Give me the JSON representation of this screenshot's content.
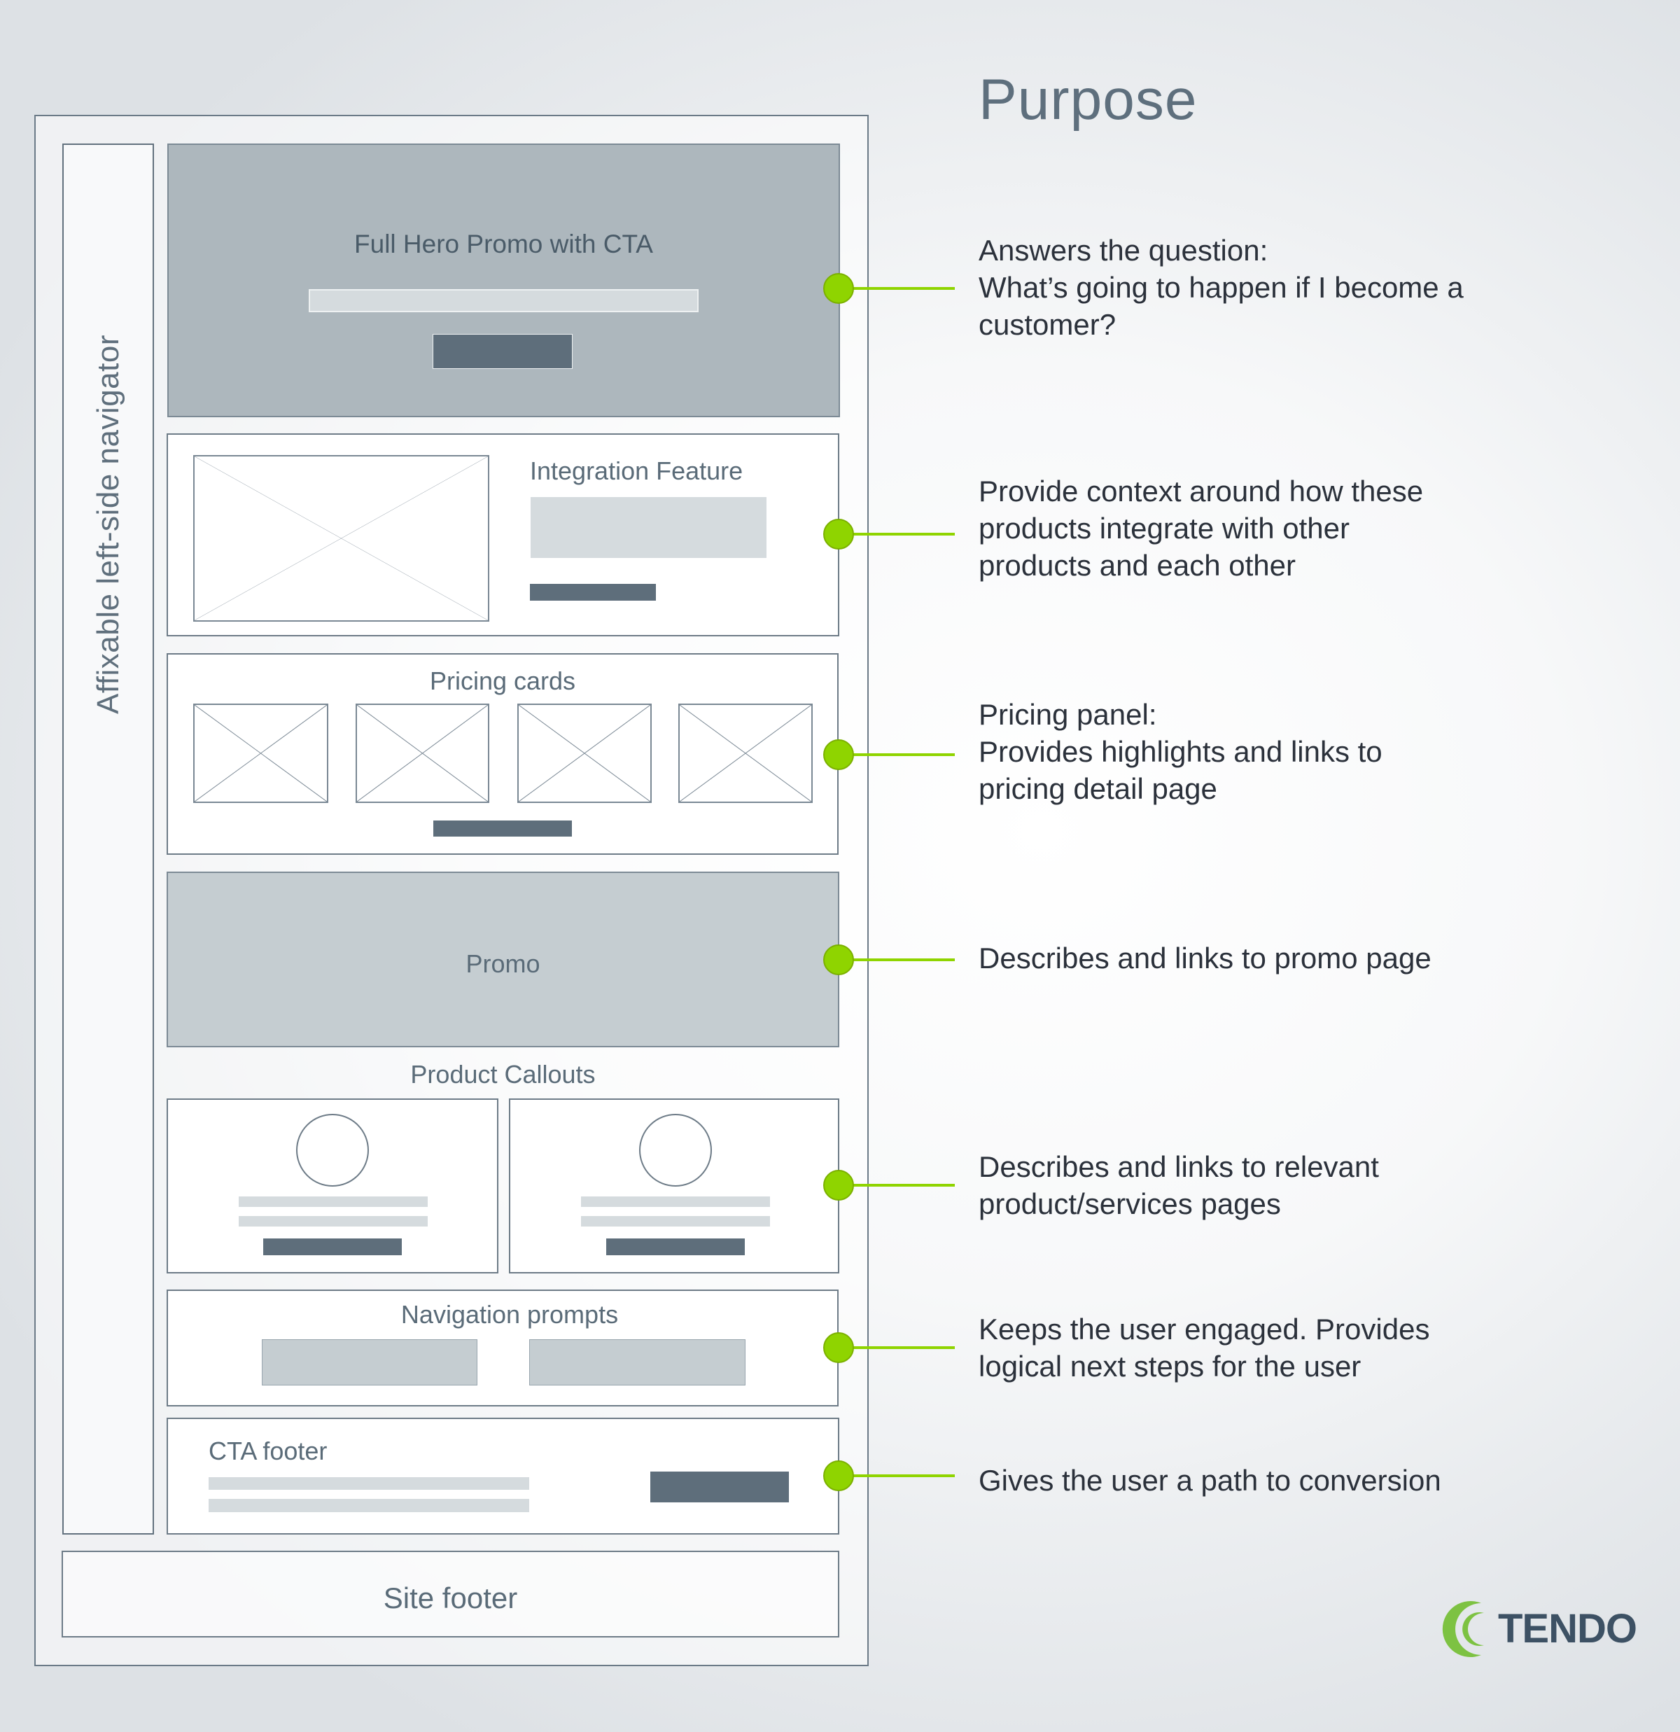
{
  "purpose_title": "Purpose",
  "wireframe": {
    "nav_label": "Affixable left-side navigator",
    "hero": {
      "title": "Full Hero Promo with CTA"
    },
    "integration": {
      "title": "Integration Feature"
    },
    "pricing": {
      "title": "Pricing cards",
      "card_count": 4
    },
    "promo": {
      "title": "Promo"
    },
    "product_callouts": {
      "title": "Product Callouts",
      "card_count": 2
    },
    "navigation_prompts": {
      "title": "Navigation prompts"
    },
    "cta_footer": {
      "title": "CTA footer"
    },
    "site_footer": {
      "title": "Site footer"
    }
  },
  "annotations": [
    {
      "section": "hero",
      "lines": [
        "Answers the question:",
        "What’s going to happen if I become a",
        "customer?"
      ]
    },
    {
      "section": "integration",
      "lines": [
        "Provide context around how these",
        "products integrate with other",
        "products and each other"
      ]
    },
    {
      "section": "pricing",
      "lines": [
        "Pricing panel:",
        "Provides highlights and links to",
        "pricing detail page"
      ]
    },
    {
      "section": "promo",
      "lines": [
        "Describes and links to promo page"
      ]
    },
    {
      "section": "product_callouts",
      "lines": [
        "Describes and links to relevant",
        "product/services pages"
      ]
    },
    {
      "section": "navigation_prompts",
      "lines": [
        "Keeps the user engaged. Provides",
        "logical next steps for the user"
      ]
    },
    {
      "section": "cta_footer",
      "lines": [
        "Gives the user a path to conversion"
      ]
    }
  ],
  "colors": {
    "accent": "#8fd400",
    "brand_green": "#7dc242",
    "brand_text": "#3d5164"
  },
  "logo": {
    "text": "TENDO",
    "icon": "tendo-swirl-icon"
  }
}
